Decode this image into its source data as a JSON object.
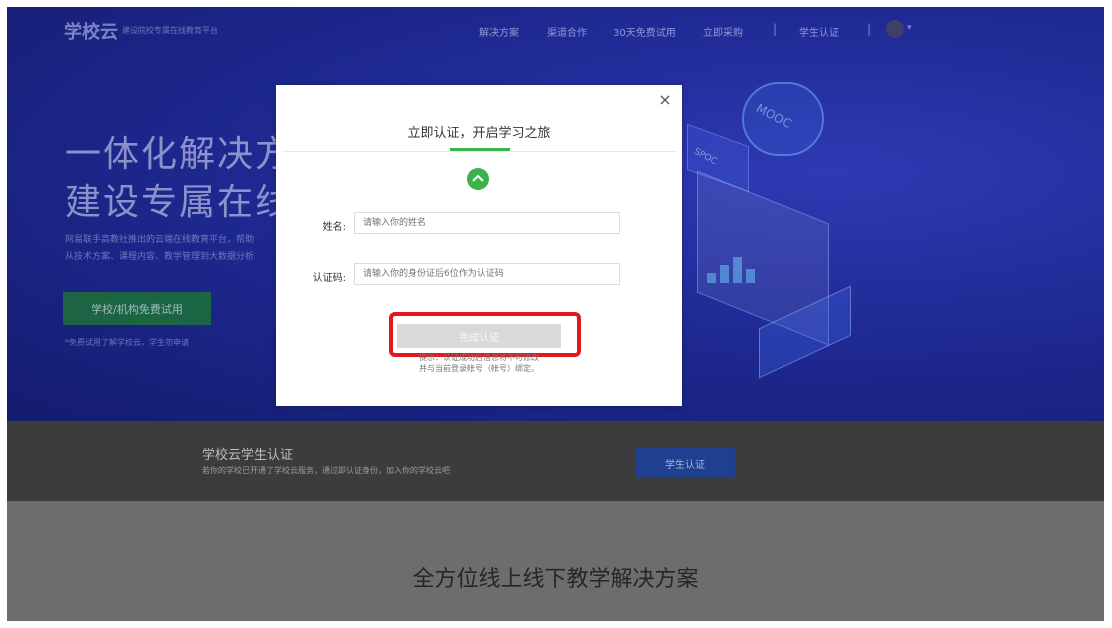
{
  "header": {
    "logo": "学校云",
    "logo_tagline": "建设院校专属在线教育平台",
    "nav": [
      "解决方案",
      "渠道合作",
      "30天免费试用",
      "立即采购",
      "学生认证"
    ]
  },
  "hero": {
    "title_line1": "一体化解决方案",
    "title_line2": "建设专属在线教育",
    "description": "网易联手高教社推出的云端在线教育平台，帮助\n从技术方案、课程内容、教学管理到大数据分析",
    "cta": "学校/机构免费试用",
    "note": "*免费试用了解学校云，学生勿申请",
    "deco_labels": [
      "MOOC",
      "SPOC"
    ]
  },
  "auth_band": {
    "title": "学校云学生认证",
    "description": "若你的学校已开通了学校云服务，通过即认证身份，加入你的学校云吧",
    "button": "学生认证"
  },
  "section": {
    "title": "全方位线上线下教学解决方案"
  },
  "modal": {
    "title": "立即认证，开启学习之旅",
    "close": "×",
    "name_label": "姓名:",
    "name_placeholder": "请输入你的姓名",
    "code_label": "认证码:",
    "code_placeholder": "请输入你的身份证后6位作为认证码",
    "submit": "完成认证",
    "tip": "提示：认证成功后信息将不可修改\n并与当前登录帐号（帐号）绑定。"
  },
  "colors": {
    "accent_green": "#38b24a",
    "highlight_red": "#e0191f",
    "hero_blue": "#1f2a94"
  }
}
